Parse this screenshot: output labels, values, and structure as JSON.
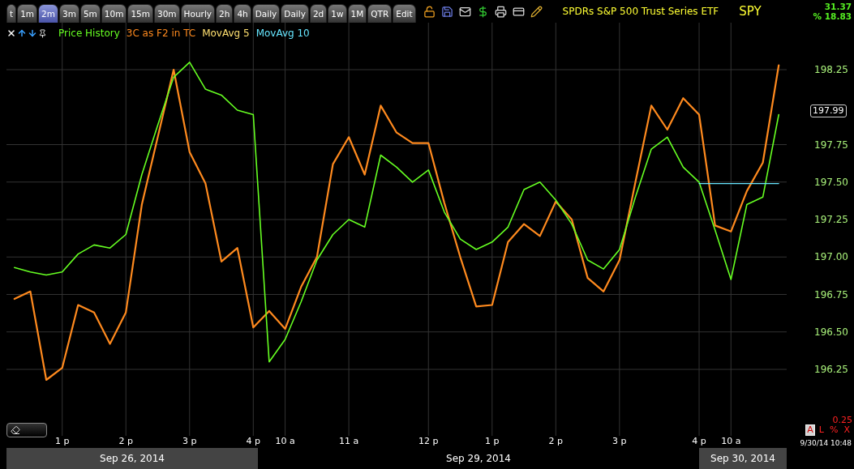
{
  "toolbar": {
    "tabs": [
      {
        "label": "t",
        "selected": false
      },
      {
        "label": "1m",
        "selected": false
      },
      {
        "label": "2m",
        "selected": true
      },
      {
        "label": "3m",
        "selected": false
      },
      {
        "label": "5m",
        "selected": false
      },
      {
        "label": "10m",
        "selected": false
      },
      {
        "label": "15m",
        "selected": false
      },
      {
        "label": "30m",
        "selected": false
      },
      {
        "label": "Hourly",
        "selected": false
      },
      {
        "label": "2h",
        "selected": false
      },
      {
        "label": "4h",
        "selected": false
      },
      {
        "label": "Daily",
        "selected": false
      },
      {
        "label": "Daily",
        "selected": false
      },
      {
        "label": "2d",
        "selected": false
      },
      {
        "label": "1w",
        "selected": false
      },
      {
        "label": "1M",
        "selected": false
      },
      {
        "label": "QTR",
        "selected": false
      },
      {
        "label": "Edit",
        "selected": false
      }
    ],
    "title": "SPDRs S&P 500 Trust Series ETF",
    "symbol": "SPY",
    "quote": {
      "value": "31.37",
      "percent": "% 18.83"
    }
  },
  "legend": [
    {
      "label": "MovAvg 5",
      "color": "#ffe070"
    }
  ],
  "chart_data": {
    "type": "line",
    "categories": [
      null,
      null,
      null,
      "1 p",
      null,
      null,
      null,
      "2 p",
      null,
      null,
      null,
      "3 p",
      null,
      null,
      null,
      "4 p",
      null,
      "10 a",
      null,
      null,
      null,
      "11 a",
      null,
      null,
      null,
      null,
      "12 p",
      null,
      null,
      null,
      "1 p",
      null,
      null,
      null,
      "2 p",
      null,
      null,
      null,
      "3 p",
      null,
      null,
      null,
      null,
      "4 p",
      null,
      "10 a",
      null,
      null,
      null
    ],
    "ylim": [
      195.8,
      198.55
    ],
    "grid": true,
    "yticks": [
      {
        "value": 196.25,
        "label": "196.25"
      },
      {
        "value": 196.5,
        "label": "196.50"
      },
      {
        "value": 196.75,
        "label": "196.75"
      },
      {
        "value": 197,
        "label": "197.00"
      },
      {
        "value": 197.25,
        "label": "197.25"
      },
      {
        "value": 197.5,
        "label": "197.50"
      },
      {
        "value": 197.75,
        "label": "197.75"
      },
      {
        "value": 198.25,
        "label": "198.25"
      }
    ],
    "series": [
      {
        "name": "Price History",
        "color": "#66ff22",
        "values": [
          196.93,
          196.9,
          196.88,
          196.9,
          197.02,
          197.08,
          197.06,
          197.15,
          197.55,
          197.88,
          198.2,
          198.3,
          198.12,
          198.08,
          197.98,
          197.95,
          196.3,
          196.45,
          196.7,
          196.98,
          197.15,
          197.25,
          197.2,
          197.68,
          197.6,
          197.5,
          197.58,
          197.3,
          197.12,
          197.05,
          197.1,
          197.2,
          197.45,
          197.5,
          197.38,
          197.22,
          196.98,
          196.92,
          197.05,
          197.4,
          197.72,
          197.8,
          197.6,
          197.5,
          197.18,
          196.85,
          197.35,
          197.4,
          197.95
        ]
      },
      {
        "name": "3C as F2 in TC",
        "color": "#ff8a1e",
        "values": [
          196.72,
          196.77,
          196.18,
          196.26,
          196.68,
          196.63,
          196.42,
          196.63,
          197.35,
          197.8,
          198.25,
          197.7,
          197.49,
          196.97,
          197.06,
          196.53,
          196.64,
          196.52,
          196.8,
          197.0,
          197.62,
          197.8,
          197.55,
          198.01,
          197.83,
          197.76,
          197.76,
          197.36,
          197.0,
          196.67,
          196.68,
          197.1,
          197.22,
          197.14,
          197.37,
          197.25,
          196.86,
          196.77,
          196.98,
          197.5,
          198.01,
          197.85,
          198.06,
          197.95,
          197.21,
          197.17,
          197.44,
          197.63,
          198.28
        ]
      },
      {
        "name": "MovAvg 10",
        "color": "#66e6ff",
        "values": [
          null,
          null,
          null,
          null,
          null,
          null,
          null,
          null,
          null,
          null,
          null,
          null,
          null,
          null,
          null,
          null,
          null,
          null,
          null,
          null,
          null,
          null,
          null,
          null,
          null,
          null,
          null,
          null,
          null,
          null,
          null,
          null,
          null,
          null,
          null,
          null,
          null,
          null,
          null,
          null,
          null,
          null,
          null,
          197.49,
          197.49,
          197.49,
          197.49,
          197.49,
          197.49
        ]
      }
    ]
  },
  "last_price": "197.99",
  "scale_value": "0.25",
  "scale_buttons": [
    {
      "label": "A",
      "selected": true
    },
    {
      "label": "L",
      "selected": false
    },
    {
      "label": "%",
      "selected": false
    },
    {
      "label": "X",
      "selected": false
    }
  ],
  "timestamp": "9/30/14 10:48",
  "dates": [
    {
      "label": "Sep 26, 2014",
      "selected": true
    },
    {
      "label": "Sep 29, 2014",
      "selected": false
    },
    {
      "label": "Sep 30, 2014",
      "selected": true
    }
  ]
}
